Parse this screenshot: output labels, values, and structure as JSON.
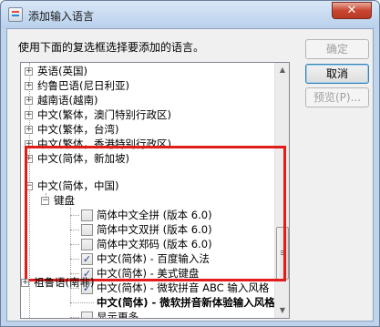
{
  "window": {
    "title": "添加输入语言",
    "close_label": "✕"
  },
  "instruction": "使用下面的复选框选择要添加的语言。",
  "buttons": {
    "ok": "确定",
    "cancel": "取消",
    "preview": "预览(P)..."
  },
  "tree": {
    "languages_top": [
      "英语(英国)",
      "约鲁巴语(尼日利亚)",
      "越南语(越南)",
      "中文(繁体，澳门特别行政区)",
      "中文(繁体，台湾)",
      "中文(繁体，香港特别行政区)",
      "中文(简体，新加坡)"
    ],
    "expanded_language": "中文(简体，中国)",
    "keyboard_group": "键盘",
    "keyboards": [
      {
        "label": "简体中文全拼 (版本 6.0)",
        "checked": false
      },
      {
        "label": "简体中文双拼 (版本 6.0)",
        "checked": false
      },
      {
        "label": "简体中文郑码 (版本 6.0)",
        "checked": false
      },
      {
        "label": "中文(简体) - 百度输入法",
        "checked": true
      },
      {
        "label": "中文(简体) - 美式键盘",
        "checked": true
      },
      {
        "label": "中文(简体) - 微软拼音 ABC 输入风格",
        "checked": true
      }
    ],
    "bold_item": "中文(简体) - 微软拼音新体验输入风格",
    "show_more": "显示更多...",
    "language_bottom": "祖鲁语(南非)"
  },
  "colors": {
    "highlight": "#e21b1b",
    "checkmark": "#22448a"
  }
}
